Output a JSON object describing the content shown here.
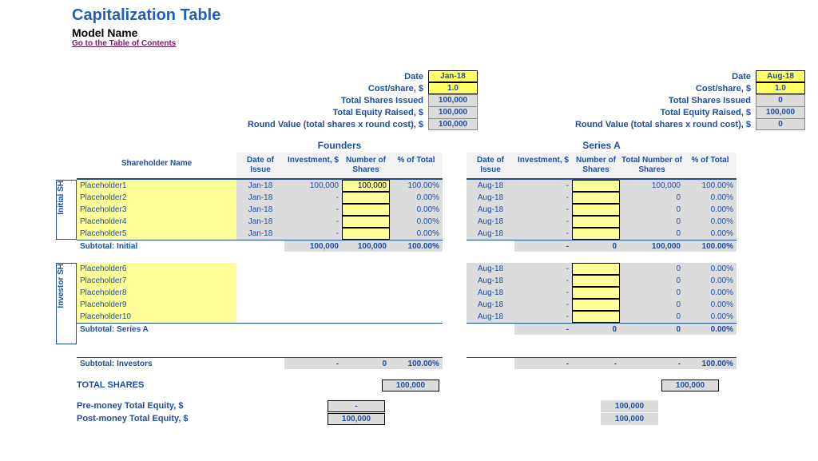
{
  "header": {
    "title": "Capitalization Table",
    "subtitle": "Model Name",
    "link": "Go to the Table of Contents"
  },
  "summary_labels": {
    "date": "Date",
    "cost": "Cost/share, $",
    "shares": "Total Shares Issued",
    "equity": "Total Equity Raised, $",
    "roundval": "Round Value (total shares x round cost), $"
  },
  "founders": {
    "title": "Founders",
    "date": "Jan-18",
    "cost": "1.0",
    "shares": "100,000",
    "equity": "100,000",
    "roundval": "100,000"
  },
  "seriesA": {
    "title": "Series A",
    "date": "Aug-18",
    "cost": "1.0",
    "shares": "0",
    "equity": "100,000",
    "roundval": "0"
  },
  "columns": {
    "sh": "Shareholder Name",
    "doi": "Date of Issue",
    "inv": "Investment, $",
    "nshares": "Number of Shares",
    "pct": "% of Total",
    "tnshares": "Total Number of Shares"
  },
  "vlabels": {
    "initial": "Initial SH",
    "investor": "Investor SH"
  },
  "initial": [
    {
      "name": "Placeholder1",
      "doi": "Jan-18",
      "inv": "100,000",
      "ns": "100,000",
      "pct": "100.00%",
      "doi2": "Aug-18",
      "inv2": "-",
      "ns2": "",
      "tns": "100,000",
      "pct2": "100.00%"
    },
    {
      "name": "Placeholder2",
      "doi": "Jan-18",
      "inv": "-",
      "ns": "",
      "pct": "0.00%",
      "doi2": "Aug-18",
      "inv2": "-",
      "ns2": "",
      "tns": "0",
      "pct2": "0.00%"
    },
    {
      "name": "Placeholder3",
      "doi": "Jan-18",
      "inv": "-",
      "ns": "",
      "pct": "0.00%",
      "doi2": "Aug-18",
      "inv2": "-",
      "ns2": "",
      "tns": "0",
      "pct2": "0.00%"
    },
    {
      "name": "Placeholder4",
      "doi": "Jan-18",
      "inv": "-",
      "ns": "",
      "pct": "0.00%",
      "doi2": "Aug-18",
      "inv2": "-",
      "ns2": "",
      "tns": "0",
      "pct2": "0.00%"
    },
    {
      "name": "Placeholder5",
      "doi": "Jan-18",
      "inv": "-",
      "ns": "",
      "pct": "0.00%",
      "doi2": "Aug-18",
      "inv2": "-",
      "ns2": "",
      "tns": "0",
      "pct2": "0.00%"
    }
  ],
  "subtotal_initial": {
    "label": "Subtotal: Initial",
    "inv": "100,000",
    "ns": "100,000",
    "pct": "100.00%",
    "inv2": "-",
    "ns2": "0",
    "tns": "100,000",
    "pct2": "100.00%"
  },
  "investors": [
    {
      "name": "Placeholder6",
      "doi2": "Aug-18",
      "inv2": "-",
      "ns2": "",
      "tns": "0",
      "pct2": "0.00%"
    },
    {
      "name": "Placeholder7",
      "doi2": "Aug-18",
      "inv2": "-",
      "ns2": "",
      "tns": "0",
      "pct2": "0.00%"
    },
    {
      "name": "Placeholder8",
      "doi2": "Aug-18",
      "inv2": "-",
      "ns2": "",
      "tns": "0",
      "pct2": "0.00%"
    },
    {
      "name": "Placeholder9",
      "doi2": "Aug-18",
      "inv2": "-",
      "ns2": "",
      "tns": "0",
      "pct2": "0.00%"
    },
    {
      "name": "Placeholder10",
      "doi2": "Aug-18",
      "inv2": "-",
      "ns2": "",
      "tns": "0",
      "pct2": "0.00%"
    }
  ],
  "subtotal_seriesA": {
    "label": "Subtotal: Series A",
    "inv2": "-",
    "ns2": "0",
    "tns": "0",
    "pct2": "0.00%"
  },
  "subtotal_investors": {
    "label": "Subtotal: Investors",
    "inv": "-",
    "ns": "0",
    "pct": "100.00%",
    "inv2": "-",
    "ns2": "-",
    "tns": "-",
    "pct2": "100.00%"
  },
  "totals": {
    "total_shares_label": "TOTAL SHARES",
    "total_shares_f": "100,000",
    "total_shares_a": "100,000",
    "pre_label": "Pre-money Total Equity, $",
    "pre_f": "-",
    "pre_a": "100,000",
    "post_label": "Post-money Total Equity, $",
    "post_f": "100,000",
    "post_a": "100,000"
  }
}
